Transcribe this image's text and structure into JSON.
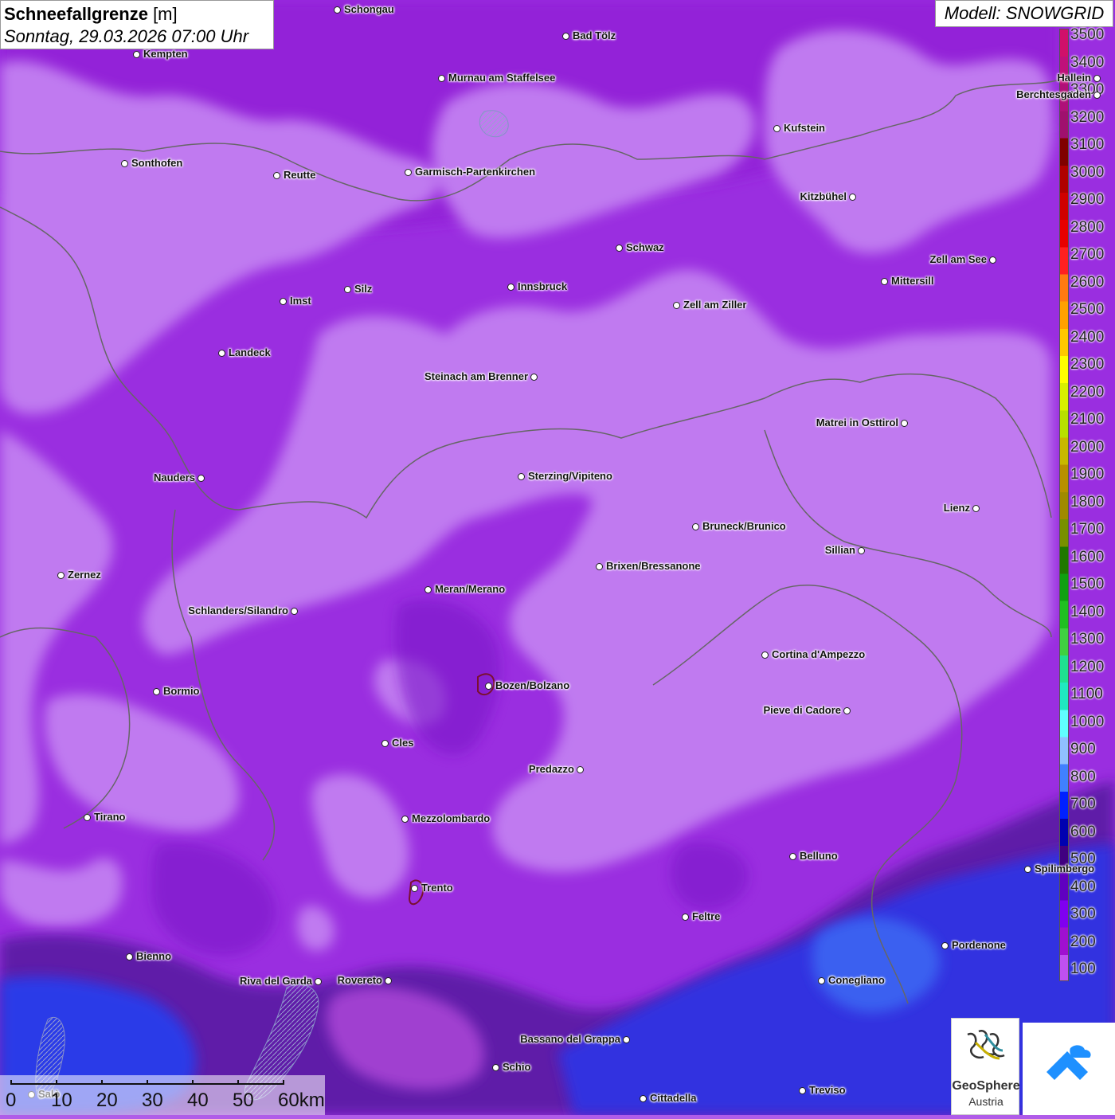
{
  "title": {
    "bold": "Schneefallgrenze",
    "unit": " [m]",
    "date": "Sonntag, 29.03.2026 07:00 Uhr"
  },
  "model": "Modell: SNOWGRID",
  "legend": {
    "labels": [
      "3500",
      "3400",
      "3300",
      "3200",
      "3100",
      "3000",
      "2900",
      "2800",
      "2700",
      "2600",
      "2500",
      "2400",
      "2300",
      "2200",
      "2100",
      "2000",
      "1900",
      "1800",
      "1700",
      "1600",
      "1500",
      "1400",
      "1300",
      "1200",
      "1100",
      "1000",
      "900",
      "800",
      "700",
      "600",
      "500",
      "400",
      "300",
      "200",
      "100"
    ],
    "colors": [
      "#d0106a",
      "#c0107a",
      "#b01078",
      "#a0106e",
      "#800000",
      "#b00000",
      "#d00000",
      "#e80000",
      "#ff2020",
      "#ff7a10",
      "#ffa000",
      "#ffc800",
      "#ffff00",
      "#d8f000",
      "#b8e000",
      "#c8b800",
      "#b89000",
      "#a08a00",
      "#789000",
      "#207800",
      "#10a010",
      "#20c020",
      "#40d040",
      "#20e090",
      "#20e8c0",
      "#60ffff",
      "#90c0ff",
      "#4080ff",
      "#0020ff",
      "#0000b0",
      "#400080",
      "#6000c0",
      "#8000f0",
      "#a010d0",
      "#c050f0"
    ]
  },
  "cities": [
    {
      "name": "Schongau"
    },
    {
      "name": "Bad Tölz"
    },
    {
      "name": "Kempten"
    },
    {
      "name": "Murnau am Staffelsee"
    },
    {
      "name": "Hallein"
    },
    {
      "name": "Berchtesgaden"
    },
    {
      "name": "Kufstein"
    },
    {
      "name": "Sonthofen"
    },
    {
      "name": "Reutte"
    },
    {
      "name": "Garmisch-Partenkirchen"
    },
    {
      "name": "Kitzbühel"
    },
    {
      "name": "Schwaz"
    },
    {
      "name": "Zell am See"
    },
    {
      "name": "Mittersill"
    },
    {
      "name": "Innsbruck"
    },
    {
      "name": "Imst"
    },
    {
      "name": "Silz"
    },
    {
      "name": "Zell am Ziller"
    },
    {
      "name": "Landeck"
    },
    {
      "name": "Steinach am Brenner"
    },
    {
      "name": "Matrei in Osttirol"
    },
    {
      "name": "Nauders"
    },
    {
      "name": "Sterzing/Vipiteno"
    },
    {
      "name": "Lienz"
    },
    {
      "name": "Bruneck/Brunico"
    },
    {
      "name": "Sillian"
    },
    {
      "name": "Zernez"
    },
    {
      "name": "Brixen/Bressanone"
    },
    {
      "name": "Meran/Merano"
    },
    {
      "name": "Schlanders/Silandro"
    },
    {
      "name": "Cortina d'Ampezzo"
    },
    {
      "name": "Bozen/Bolzano"
    },
    {
      "name": "Bormio"
    },
    {
      "name": "Pieve di Cadore"
    },
    {
      "name": "Cles"
    },
    {
      "name": "Predazzo"
    },
    {
      "name": "Tirano"
    },
    {
      "name": "Mezzolombardo"
    },
    {
      "name": "Belluno"
    },
    {
      "name": "Spilimbergo"
    },
    {
      "name": "Trento"
    },
    {
      "name": "Feltre"
    },
    {
      "name": "Pordenone"
    },
    {
      "name": "Bienno"
    },
    {
      "name": "Riva del Garda"
    },
    {
      "name": "Rovereto"
    },
    {
      "name": "Conegliano"
    },
    {
      "name": "Bassano del Grappa"
    },
    {
      "name": "Schio"
    },
    {
      "name": "Treviso"
    },
    {
      "name": "Cittadella"
    },
    {
      "name": "Salò"
    }
  ],
  "scale": {
    "labels": [
      "0",
      "10",
      "20",
      "30",
      "40",
      "50",
      "60km"
    ]
  },
  "logo": {
    "name": "GeoSphere",
    "sub": "Austria"
  }
}
